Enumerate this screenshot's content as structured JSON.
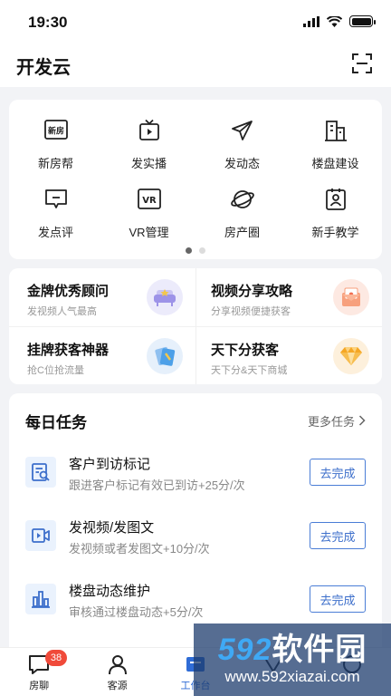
{
  "status": {
    "time": "19:30"
  },
  "header": {
    "title": "开发云"
  },
  "shortcuts": [
    {
      "label": "新房帮",
      "icon": "xinfang-icon"
    },
    {
      "label": "发实播",
      "icon": "tv-icon"
    },
    {
      "label": "发动态",
      "icon": "send-icon"
    },
    {
      "label": "楼盘建设",
      "icon": "building-icon"
    },
    {
      "label": "发点评",
      "icon": "comment-icon"
    },
    {
      "label": "VR管理",
      "icon": "vr-icon"
    },
    {
      "label": "房产圈",
      "icon": "planet-icon"
    },
    {
      "label": "新手教学",
      "icon": "teacher-icon"
    }
  ],
  "shortcut_icon_text": {
    "xinfang": "新房",
    "vr": "VR"
  },
  "promos": [
    {
      "title": "金牌优秀顾问",
      "sub": "发视频人气最高",
      "icon": "sofa-icon",
      "color": "#ecebfb"
    },
    {
      "title": "视频分享攻略",
      "sub": "分享视频便捷获客",
      "icon": "mail-icon",
      "color": "#fde9e2"
    },
    {
      "title": "挂牌获客神器",
      "sub": "抢C位抢流量",
      "icon": "cards-icon",
      "color": "#e6f0fb"
    },
    {
      "title": "天下分获客",
      "sub": "天下分&天下商城",
      "icon": "diamond-icon",
      "color": "#fdf0dc"
    }
  ],
  "tasks": {
    "title": "每日任务",
    "more": "更多任务",
    "items": [
      {
        "title": "客户到访标记",
        "desc": "跟进客户标记有效已到访+25分/次",
        "button": "去完成",
        "icon": "visit-icon"
      },
      {
        "title": "发视频/发图文",
        "desc": "发视频或者发图文+10分/次",
        "button": "去完成",
        "icon": "video-icon"
      },
      {
        "title": "楼盘动态维护",
        "desc": "审核通过楼盘动态+5分/次",
        "button": "去完成",
        "icon": "chart-icon"
      }
    ]
  },
  "tabbar": [
    {
      "label": "房聊",
      "badge": "38"
    },
    {
      "label": "客源"
    },
    {
      "label": "工作台"
    },
    {
      "label": ""
    },
    {
      "label": ""
    }
  ],
  "watermark": {
    "brand_num": "592",
    "brand_text": "软件园",
    "url": "www.592xiazai.com"
  },
  "colors": {
    "accent": "#2f6cd6",
    "badge": "#f04a3a"
  }
}
